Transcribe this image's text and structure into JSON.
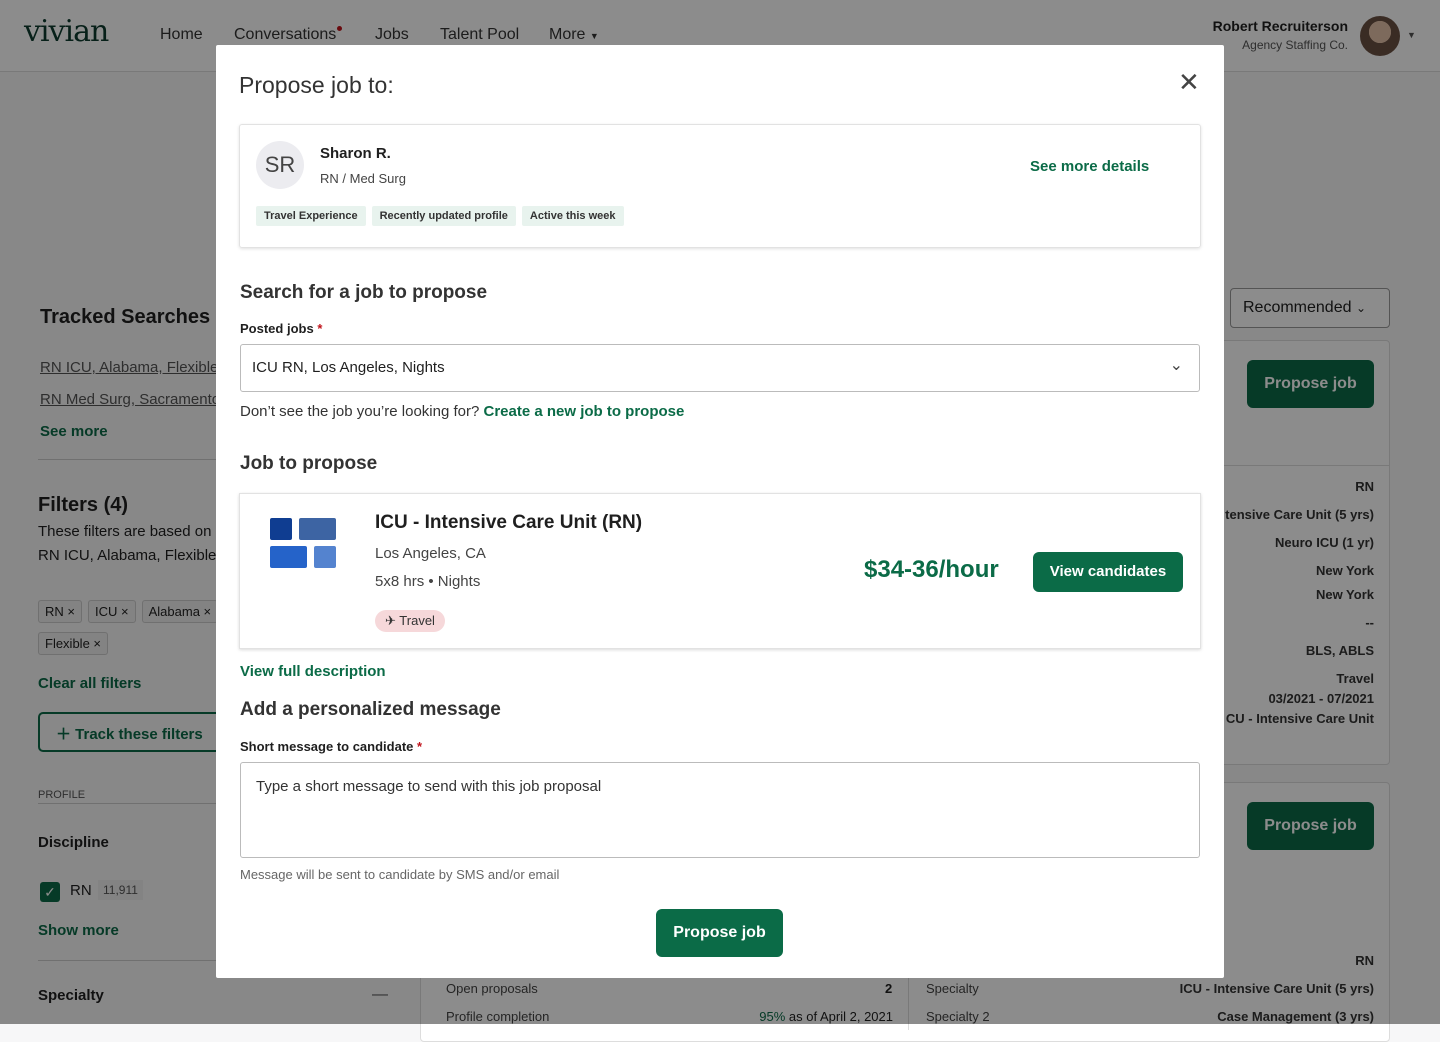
{
  "header": {
    "logo": "vivian",
    "nav": [
      {
        "label": "Home"
      },
      {
        "label": "Conversations"
      },
      {
        "label": "Jobs"
      },
      {
        "label": "Talent Pool"
      },
      {
        "label": "More"
      }
    ],
    "user_name": "Robert Recruiterson",
    "user_org": "Agency Staffing Co."
  },
  "sidebar": {
    "tracked_title": "Tracked Searches (",
    "tracked": [
      "RN ICU, Alabama, Flexible",
      "RN Med Surg, Sacramento"
    ],
    "see_more": "See more",
    "filters_title": "Filters (4)",
    "filters_desc1": "These filters are based on",
    "filters_desc2": "RN ICU, Alabama, Flexible",
    "chips": [
      "RN",
      "ICU",
      "Alabama",
      "Flexible"
    ],
    "clear": "Clear all filters",
    "track": "Track these filters",
    "profile": "PROFILE",
    "discipline": "Discipline",
    "rn_label": "RN",
    "rn_count": "11,911",
    "show_more": "Show more",
    "specialty": "Specialty"
  },
  "results": {
    "sort": "Recommended",
    "propose_label": "Propose job",
    "card1_values": [
      "RN",
      "tensive Care Unit (5 yrs)",
      "Neuro ICU (1 yr)",
      "New York",
      "New York",
      "--",
      "BLS, ABLS",
      "Travel",
      "03/2021 - 07/2021",
      "CU - Intensive Care Unit"
    ],
    "card2": {
      "rn": "RN",
      "rows": [
        {
          "label": "Open proposals",
          "value": "2"
        },
        {
          "label": "Profile completion",
          "pct": "95%",
          "value": " as of April 2, 2021"
        }
      ],
      "rows_right": [
        {
          "label": "Specialty",
          "value": "ICU - Intensive Care Unit (5 yrs)"
        },
        {
          "label": "Specialty 2",
          "value": "Case Management (3 yrs)"
        }
      ]
    }
  },
  "modal": {
    "title": "Propose job to:",
    "candidate": {
      "initials": "SR",
      "name": "Sharon R.",
      "role": "RN / Med Surg",
      "tags": [
        "Travel Experience",
        "Recently updated profile",
        "Active this week"
      ],
      "details_link": "See more details"
    },
    "search_heading": "Search for a job to propose",
    "posted_label": "Posted jobs",
    "required": "*",
    "posted_value": "ICU RN, Los Angeles, Nights",
    "dont_see": "Don’t see the job you’re looking for?",
    "create_link": "Create a new job to propose",
    "job_heading": "Job to propose",
    "job": {
      "title": "ICU - Intensive Care Unit (RN)",
      "location": "Los Angeles, CA",
      "schedule": "5x8 hrs",
      "shift": "Nights",
      "tag": "Travel",
      "rate": "$34-36/hour",
      "view_candidates": "View candidates"
    },
    "full_desc": "View full description",
    "msg_heading": "Add a personalized message",
    "msg_label": "Short message to candidate",
    "msg_placeholder": "Type a short message to send with this job proposal",
    "msg_hint": "Message will be sent to candidate by SMS and/or email",
    "submit": "Propose job"
  },
  "colors": {
    "accent": "#0b6b47",
    "required": "#c0131b"
  }
}
